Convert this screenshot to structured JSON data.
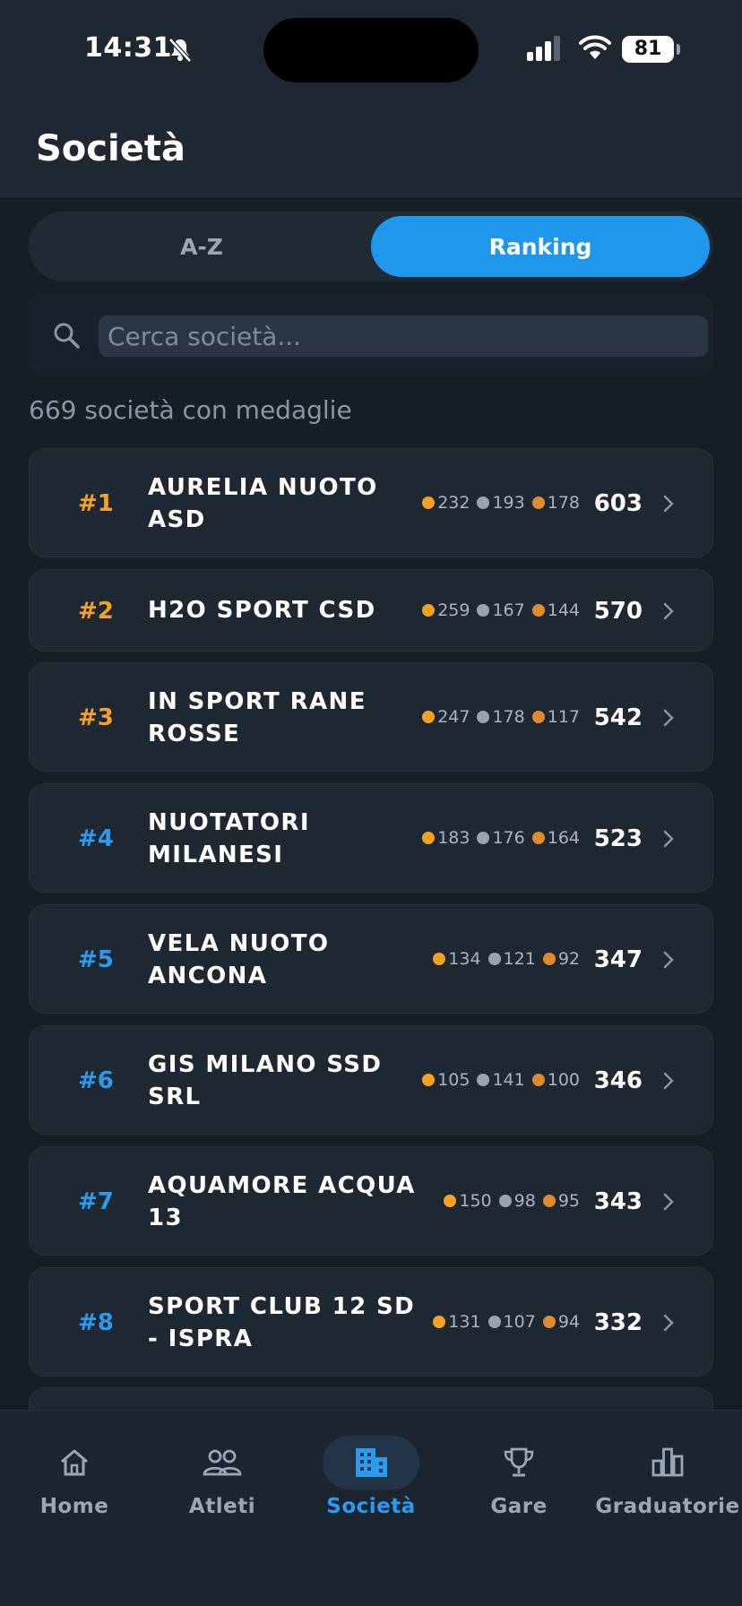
{
  "status_bar": {
    "time": "14:31",
    "battery": "81"
  },
  "header": {
    "title": "Società"
  },
  "segments": {
    "az_label": "A-Z",
    "ranking_label": "Ranking",
    "selected": "Ranking"
  },
  "search": {
    "placeholder": "Cerca società..."
  },
  "summary": {
    "count_text": "669 società con medaglie"
  },
  "colors": {
    "gold": "#f5a124",
    "silver": "#9aa3ad",
    "bronze": "#e08a2a",
    "accent": "#1f97ec"
  },
  "clubs": [
    {
      "rank": "#1",
      "name": "AURELIA NUOTO ASD",
      "gold": "232",
      "silver": "193",
      "bronze": "178",
      "total": "603"
    },
    {
      "rank": "#2",
      "name": "H2O SPORT CSD",
      "gold": "259",
      "silver": "167",
      "bronze": "144",
      "total": "570"
    },
    {
      "rank": "#3",
      "name": "IN SPORT RANE ROSSE",
      "gold": "247",
      "silver": "178",
      "bronze": "117",
      "total": "542"
    },
    {
      "rank": "#4",
      "name": "NUOTATORI MILANESI",
      "gold": "183",
      "silver": "176",
      "bronze": "164",
      "total": "523"
    },
    {
      "rank": "#5",
      "name": "VELA NUOTO ANCONA",
      "gold": "134",
      "silver": "121",
      "bronze": "92",
      "total": "347"
    },
    {
      "rank": "#6",
      "name": "GIS MILANO SSD SRL",
      "gold": "105",
      "silver": "141",
      "bronze": "100",
      "total": "346"
    },
    {
      "rank": "#7",
      "name": "AQUAMORE ACQUA 13",
      "gold": "150",
      "silver": "98",
      "bronze": "95",
      "total": "343"
    },
    {
      "rank": "#8",
      "name": "SPORT CLUB 12 SD - ISPRA",
      "gold": "131",
      "silver": "107",
      "bronze": "94",
      "total": "332"
    }
  ],
  "nav": {
    "items": [
      {
        "label": "Home",
        "icon": "home-icon"
      },
      {
        "label": "Atleti",
        "icon": "people-icon"
      },
      {
        "label": "Società",
        "icon": "building-icon",
        "active": true
      },
      {
        "label": "Gare",
        "icon": "trophy-icon"
      },
      {
        "label": "Graduatorie",
        "icon": "bar-chart-icon"
      }
    ]
  }
}
